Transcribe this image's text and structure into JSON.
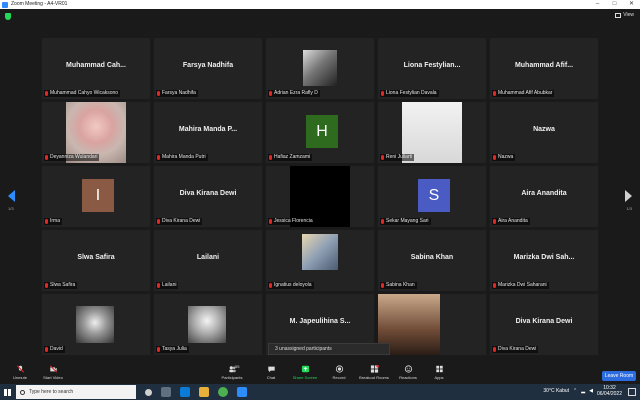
{
  "window": {
    "title": "Zoom Meeting - A4-VR01",
    "controls": [
      "–",
      "□",
      "✕"
    ]
  },
  "header": {
    "view_label": "View"
  },
  "pagination": {
    "left": "1/3",
    "right": "1/3"
  },
  "colors": {
    "accent": "#2d8cff",
    "mic_off": "#e02828",
    "shield": "#23d959",
    "leave": "#2d6cdf"
  },
  "participants": [
    {
      "display": "Muhammad Cah...",
      "label": "Muhammad Cahyo Wicaksono",
      "kind": "name"
    },
    {
      "display": "Farsya Nadhifa",
      "label": "Farsya Nadhifa",
      "kind": "name"
    },
    {
      "display": "",
      "label": "Adrian Ezra Rafly D",
      "kind": "photo",
      "photo": "bw-room"
    },
    {
      "display": "Liona Festylian...",
      "label": "Liona Festylian Davala",
      "kind": "name"
    },
    {
      "display": "Muhammad Afif...",
      "label": "Muhammad Afif Abubkar",
      "kind": "name"
    },
    {
      "display": "",
      "label": "Deyanniza Wulandari",
      "kind": "photo",
      "photo": "portrait-pink"
    },
    {
      "display": "Mahira Manda P...",
      "label": "Mahira Manda Putri",
      "kind": "name"
    },
    {
      "display": "H",
      "label": "Hafiaz Zamzami",
      "kind": "avatar",
      "color": "#2e6b1e"
    },
    {
      "display": "",
      "label": "Reni Juliarti",
      "kind": "photo",
      "photo": "light-wall"
    },
    {
      "display": "Nazwa",
      "label": "Nazwa",
      "kind": "name"
    },
    {
      "display": "I",
      "label": "Irma",
      "kind": "avatar",
      "color": "#8a5a44"
    },
    {
      "display": "Diva Kirana Dewi",
      "label": "Diva Kirana Dewi",
      "kind": "name"
    },
    {
      "display": "",
      "label": "Jessica Florencia",
      "kind": "photo",
      "photo": "black"
    },
    {
      "display": "S",
      "label": "Sekar Mayang Sari",
      "kind": "avatar",
      "color": "#4a5bc4"
    },
    {
      "display": "Aira Ananditа",
      "label": "Aira Anandita",
      "kind": "name"
    },
    {
      "display": "Slwa Safira",
      "label": "Slwa Safira",
      "kind": "name"
    },
    {
      "display": "Lailani",
      "label": "Lailani",
      "kind": "name"
    },
    {
      "display": "",
      "label": "Ignatius deloyola",
      "kind": "photo",
      "photo": "screen"
    },
    {
      "display": "Sabina Khan",
      "label": "Sabina Khan",
      "kind": "name"
    },
    {
      "display": "Marizka Dwi Sah...",
      "label": "Marizka Dwi Saharani",
      "kind": "name"
    },
    {
      "display": "",
      "label": "David",
      "kind": "photo",
      "photo": "bw-face"
    },
    {
      "display": "",
      "label": "Tasya Julia",
      "kind": "photo",
      "photo": "bw-girl"
    },
    {
      "display": "M. Japeulihina S...",
      "label": "M. Japeulihina Senda S",
      "kind": "name"
    },
    {
      "display": "",
      "label": "",
      "kind": "photo",
      "photo": "person-room"
    },
    {
      "display": "Diva Kirana Dewi",
      "label": "Diva Kirana Dewi",
      "kind": "name"
    }
  ],
  "tooltip": "3 unassigned participants",
  "toolbar": {
    "unmute": "Unmute",
    "start_video": "Start Video",
    "participants": "Participants",
    "participants_count": "55",
    "chat": "Chat",
    "share_screen": "Share Screen",
    "record": "Record",
    "breakout_rooms": "Breakout Rooms",
    "reactions": "Reactions",
    "apps": "Apps",
    "leave": "Leave Room"
  },
  "taskbar": {
    "search_placeholder": "Type here to search",
    "weather": "30°C  Kabut",
    "time": "10:32",
    "date": "06/04/2022"
  }
}
